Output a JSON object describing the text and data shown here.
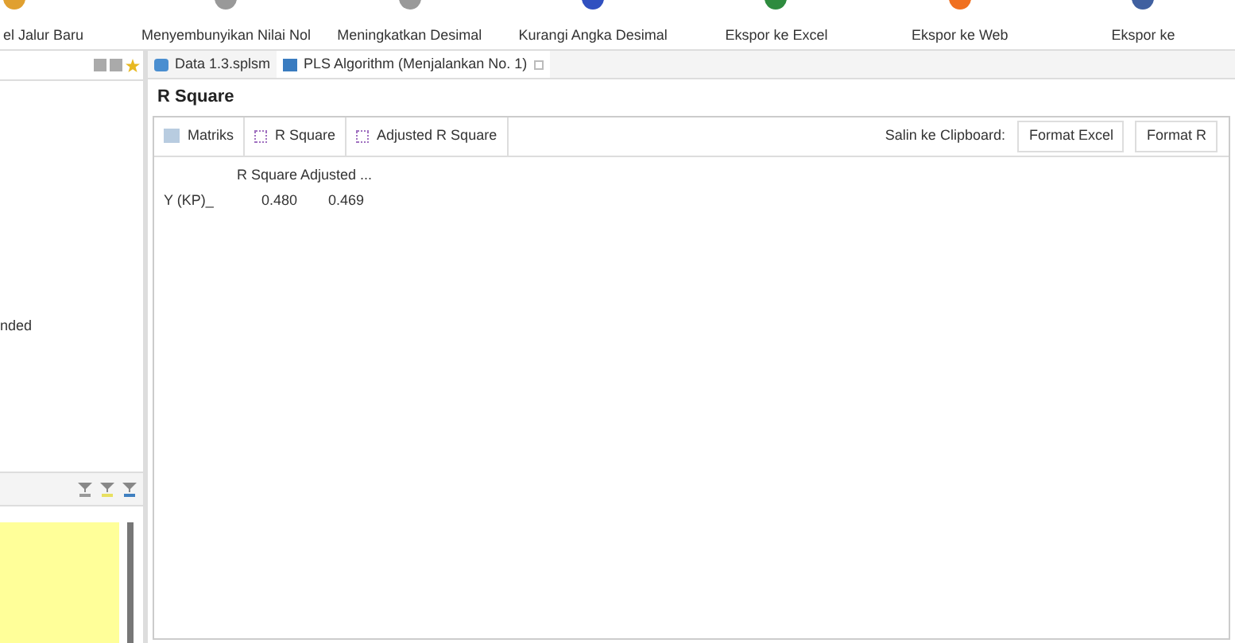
{
  "toolbar": [
    {
      "label": "el Jalur Baru",
      "color": "#e0a030"
    },
    {
      "label": "Menyembunyikan Nilai Nol",
      "color": "#999999"
    },
    {
      "label": "Meningkatkan Desimal",
      "color": "#999999"
    },
    {
      "label": "Kurangi Angka Desimal",
      "color": "#3050c0"
    },
    {
      "label": "Ekspor ke Excel",
      "color": "#2e8b3e"
    },
    {
      "label": "Ekspor ke Web",
      "color": "#f07020"
    },
    {
      "label": "Ekspor ke",
      "color": "#4060a0"
    }
  ],
  "editor_tabs": [
    {
      "label": "Data 1.3.splsm",
      "selected": false
    },
    {
      "label": "PLS Algorithm (Menjalankan No. 1)",
      "selected": true
    }
  ],
  "left_panel": {
    "text": "nded"
  },
  "report": {
    "title": "R Square",
    "view_tabs": [
      "Matriks",
      "R Square",
      "Adjusted R Square"
    ],
    "clipboard_label": "Salin ke Clipboard:",
    "clipboard_buttons": [
      "Format Excel",
      "Format R"
    ],
    "table": {
      "columns": [
        "R Square",
        "Adjusted ..."
      ],
      "rows": [
        {
          "label": "Y (KP)_",
          "values": [
            "0.480",
            "0.469"
          ]
        }
      ]
    }
  }
}
